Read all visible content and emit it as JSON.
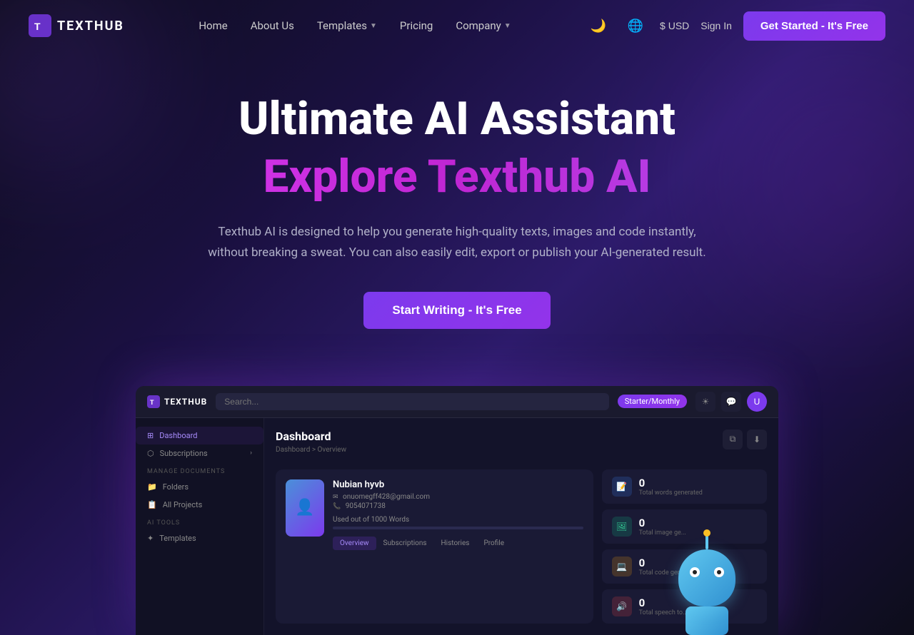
{
  "brand": {
    "name": "TEXTHUB",
    "logo_symbol": "T"
  },
  "navbar": {
    "links": [
      {
        "id": "home",
        "label": "Home",
        "has_dropdown": false
      },
      {
        "id": "about",
        "label": "About Us",
        "has_dropdown": false
      },
      {
        "id": "templates",
        "label": "Templates",
        "has_dropdown": true
      },
      {
        "id": "pricing",
        "label": "Pricing",
        "has_dropdown": false
      },
      {
        "id": "company",
        "label": "Company",
        "has_dropdown": true
      }
    ],
    "currency": "$ USD",
    "signin_label": "Sign In",
    "cta_label": "Get Started - It's Free"
  },
  "hero": {
    "title_line1": "Ultimate AI Assistant",
    "title_line2": "Explore Texthub AI",
    "description": "Texthub AI is designed to help you generate high-quality texts, images and code instantly, without breaking a sweat. You can also easily edit, export or publish your AI-generated result.",
    "cta_label": "Start Writing - It's Free"
  },
  "preview": {
    "plan_badge": "Starter/Monthly",
    "search_placeholder": "Search...",
    "dashboard_title": "Dashboard",
    "breadcrumb": "Dashboard > Overview",
    "user": {
      "name": "Nubian hyvb",
      "email": "onuomegff428@gmail.com",
      "phone": "9054071738",
      "words_used": "0",
      "words_total": "1000",
      "words_label": "Used out of 1000 Words",
      "progress_percent": 0
    },
    "tabs": [
      "Overview",
      "Subscriptions",
      "Histories",
      "Profile"
    ],
    "stats": [
      {
        "icon": "📝",
        "value": "0",
        "label": "Total words generated",
        "color": "blue"
      },
      {
        "icon": "🖼",
        "value": "0",
        "label": "Total image ge...",
        "color": "green"
      },
      {
        "icon": "💻",
        "value": "0",
        "label": "Total code generated",
        "color": "orange"
      },
      {
        "icon": "🔊",
        "value": "0",
        "label": "Total speech to...",
        "color": "red"
      }
    ],
    "sidebar": {
      "items": [
        {
          "label": "Dashboard",
          "active": true,
          "icon": "⊞"
        },
        {
          "label": "Subscriptions",
          "active": false,
          "icon": "⬡"
        }
      ],
      "manage_section": "MANAGE DOCUMENTS",
      "manage_items": [
        {
          "label": "Folders",
          "icon": "📁"
        },
        {
          "label": "All Projects",
          "icon": "📋"
        }
      ],
      "ai_section": "AI TOOLS",
      "ai_items": [
        {
          "label": "Templates",
          "icon": "✦"
        }
      ]
    },
    "top_buttons": [
      "copy",
      "download"
    ]
  }
}
